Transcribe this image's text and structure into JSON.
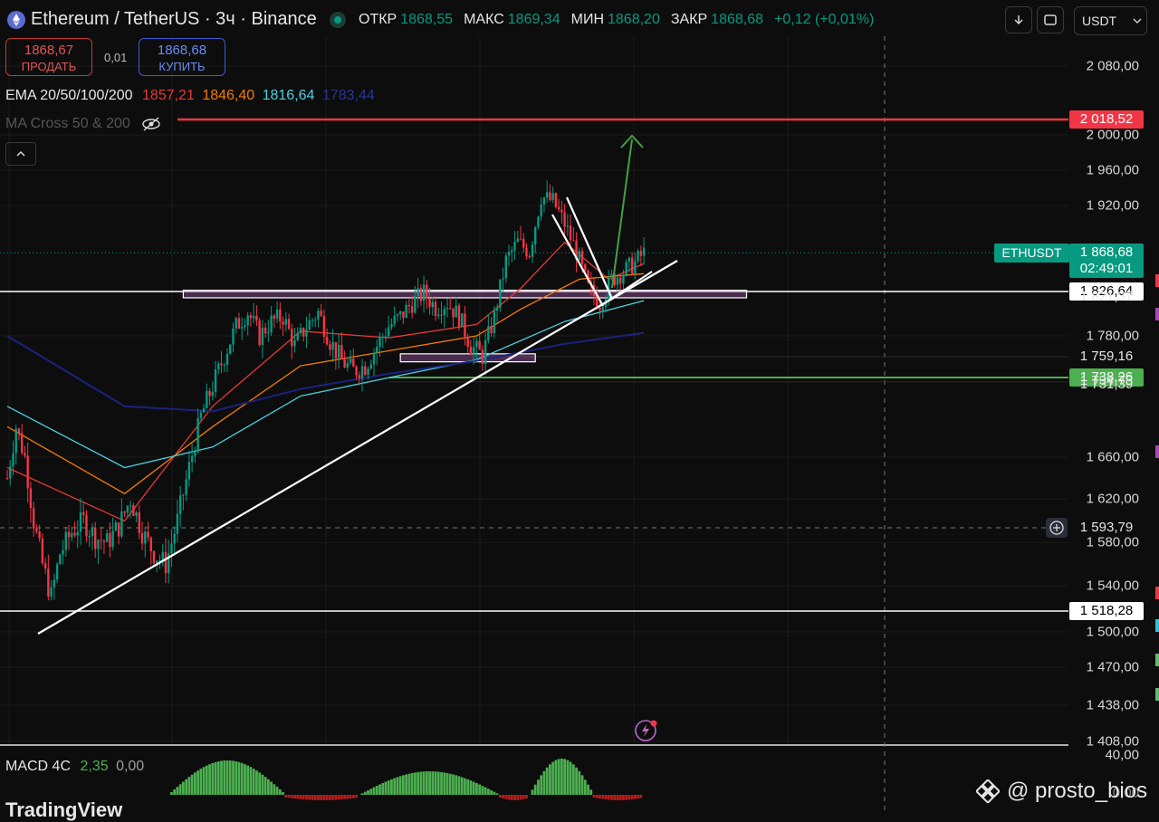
{
  "header": {
    "title": "Ethereum / TetherUS · 3ч · Binance",
    "ohlc": [
      {
        "label": "ОТКР",
        "value": "1868,55"
      },
      {
        "label": "МАКС",
        "value": "1869,34"
      },
      {
        "label": "МИН",
        "value": "1868,20"
      },
      {
        "label": "ЗАКР",
        "value": "1868,68"
      }
    ],
    "change": "+0,12 (+0,01%)",
    "currency": "USDT"
  },
  "trade": {
    "sell_price": "1868,67",
    "sell_label": "ПРОДАТЬ",
    "spread": "0,01",
    "buy_price": "1868,68",
    "buy_label": "КУПИТЬ"
  },
  "indicators": {
    "ema_name": "EMA 20/50/100/200",
    "ema_values": [
      {
        "value": "1857,21",
        "color": "#e53935"
      },
      {
        "value": "1846,40",
        "color": "#f57c00"
      },
      {
        "value": "1816,64",
        "color": "#4dd0e1"
      },
      {
        "value": "1783,44",
        "color": "#1a237e"
      }
    ],
    "ma_cross": "MA Cross 50 & 200",
    "macd_name": "MACD 4C",
    "macd_value": "2,35",
    "macd_zero": "0,00"
  },
  "price_axis": [
    {
      "label": "2 080,00",
      "price": 2080
    },
    {
      "label": "2 000,00",
      "price": 2000
    },
    {
      "label": "1 960,00",
      "price": 1960
    },
    {
      "label": "1 920,00",
      "price": 1920
    },
    {
      "label": "1 780,00",
      "price": 1780
    },
    {
      "label": "1 660,00",
      "price": 1660
    },
    {
      "label": "1 620,00",
      "price": 1620
    },
    {
      "label": "1 580,00",
      "price": 1580
    },
    {
      "label": "1 540,00",
      "price": 1540
    },
    {
      "label": "1 500,00",
      "price": 1500
    },
    {
      "label": "1 470,00",
      "price": 1470
    },
    {
      "label": "1 438,00",
      "price": 1438
    },
    {
      "label": "1 408,00",
      "price": 1408
    }
  ],
  "price_tags": [
    {
      "label": "2 018,52",
      "price": 2018.52,
      "style": "red"
    },
    {
      "label": "1 826,64",
      "price": 1826.64,
      "style": "white"
    },
    {
      "label": "1 821,37",
      "price": 1821.37,
      "style": "plain"
    },
    {
      "label": "1 759,16",
      "price": 1759.16,
      "style": "plain"
    },
    {
      "label": "1 738,26",
      "price": 1738.26,
      "style": "green"
    },
    {
      "label": "1 734,73",
      "price": 1734.73,
      "style": "plain"
    },
    {
      "label": "1 731,39",
      "price": 1731.39,
      "style": "plain"
    },
    {
      "label": "1 593,79",
      "price": 1593.79,
      "style": "plain"
    },
    {
      "label": "1 518,28",
      "price": 1518.28,
      "style": "white"
    }
  ],
  "last_price": {
    "symbol": "ETHUSDT",
    "price": "1 868,68",
    "countdown": "02:49:01"
  },
  "macd_axis": {
    "top": "40,00",
    "bottom": "0,00"
  },
  "branding": {
    "logo": "TradingView",
    "watermark": "@ prosto_bios"
  },
  "colors": {
    "up": "#089981",
    "down": "#f23645",
    "background": "#0d0d0d"
  },
  "chart_data": {
    "type": "candlestick",
    "symbol": "ETHUSDT",
    "timeframe": "3ч",
    "ylim": [
      1408,
      2080
    ],
    "close_path": [
      [
        0,
        1640
      ],
      [
        3,
        1690
      ],
      [
        6,
        1660
      ],
      [
        9,
        1600
      ],
      [
        12,
        1560
      ],
      [
        15,
        1530
      ],
      [
        18,
        1570
      ],
      [
        22,
        1590
      ],
      [
        26,
        1600
      ],
      [
        30,
        1585
      ],
      [
        34,
        1580
      ],
      [
        38,
        1595
      ],
      [
        42,
        1620
      ],
      [
        46,
        1590
      ],
      [
        50,
        1570
      ],
      [
        54,
        1560
      ],
      [
        58,
        1600
      ],
      [
        62,
        1650
      ],
      [
        66,
        1700
      ],
      [
        70,
        1730
      ],
      [
        74,
        1760
      ],
      [
        78,
        1790
      ],
      [
        82,
        1805
      ],
      [
        86,
        1780
      ],
      [
        90,
        1795
      ],
      [
        94,
        1800
      ],
      [
        98,
        1770
      ],
      [
        102,
        1790
      ],
      [
        106,
        1805
      ],
      [
        110,
        1775
      ],
      [
        114,
        1755
      ],
      [
        118,
        1745
      ],
      [
        122,
        1750
      ],
      [
        126,
        1770
      ],
      [
        130,
        1790
      ],
      [
        134,
        1800
      ],
      [
        138,
        1815
      ],
      [
        142,
        1825
      ],
      [
        146,
        1810
      ],
      [
        150,
        1815
      ],
      [
        154,
        1800
      ],
      [
        158,
        1770
      ],
      [
        162,
        1760
      ],
      [
        166,
        1800
      ],
      [
        170,
        1860
      ],
      [
        174,
        1880
      ],
      [
        178,
        1870
      ],
      [
        182,
        1930
      ],
      [
        186,
        1925
      ],
      [
        190,
        1900
      ],
      [
        194,
        1870
      ],
      [
        198,
        1830
      ],
      [
        202,
        1815
      ],
      [
        206,
        1840
      ],
      [
        210,
        1848
      ],
      [
        214,
        1858
      ],
      [
        217,
        1868.68
      ]
    ],
    "ema_lines": [
      {
        "name": "EMA 20",
        "value": 1857.21,
        "color": "#e53935",
        "points": [
          [
            0,
            1650
          ],
          [
            40,
            1600
          ],
          [
            70,
            1710
          ],
          [
            100,
            1785
          ],
          [
            130,
            1778
          ],
          [
            160,
            1792
          ],
          [
            175,
            1830
          ],
          [
            190,
            1880
          ],
          [
            205,
            1840
          ],
          [
            217,
            1857
          ]
        ]
      },
      {
        "name": "EMA 50",
        "value": 1846.4,
        "color": "#f57c00",
        "points": [
          [
            0,
            1690
          ],
          [
            40,
            1625
          ],
          [
            70,
            1690
          ],
          [
            100,
            1750
          ],
          [
            130,
            1765
          ],
          [
            160,
            1780
          ],
          [
            175,
            1808
          ],
          [
            195,
            1840
          ],
          [
            217,
            1846
          ]
        ]
      },
      {
        "name": "EMA 100",
        "value": 1816.64,
        "color": "#4dd0e1",
        "points": [
          [
            0,
            1710
          ],
          [
            40,
            1650
          ],
          [
            70,
            1670
          ],
          [
            100,
            1720
          ],
          [
            130,
            1738
          ],
          [
            160,
            1756
          ],
          [
            190,
            1795
          ],
          [
            217,
            1817
          ]
        ]
      },
      {
        "name": "EMA 200",
        "value": 1783.44,
        "color": "#1a237e",
        "points": [
          [
            0,
            1780
          ],
          [
            40,
            1710
          ],
          [
            70,
            1705
          ],
          [
            100,
            1727
          ],
          [
            130,
            1742
          ],
          [
            160,
            1755
          ],
          [
            190,
            1772
          ],
          [
            217,
            1783
          ]
        ]
      }
    ],
    "horizontal_levels": [
      2018.52,
      1826.64,
      1738.26,
      1593.79,
      1518.28
    ],
    "zones": [
      {
        "from_bar": 60,
        "to_bar": 252,
        "price_high": 1828,
        "price_low": 1820
      },
      {
        "from_bar": 134,
        "to_bar": 180,
        "price_high": 1762,
        "price_low": 1754
      }
    ],
    "macd_histogram": [
      {
        "from_bar": 55,
        "to_bar": 95,
        "peak": 38,
        "color": "#4caf50"
      },
      {
        "from_bar": 95,
        "to_bar": 120,
        "peak": 0,
        "color": "#b71c1c"
      },
      {
        "from_bar": 120,
        "to_bar": 168,
        "peak": 26,
        "color": "#4caf50"
      },
      {
        "from_bar": 168,
        "to_bar": 178,
        "peak": 0,
        "color": "#b71c1c"
      },
      {
        "from_bar": 178,
        "to_bar": 200,
        "peak": 40,
        "color": "#4caf50"
      },
      {
        "from_bar": 200,
        "to_bar": 217,
        "peak": 0,
        "color": "#b71c1c"
      }
    ]
  }
}
